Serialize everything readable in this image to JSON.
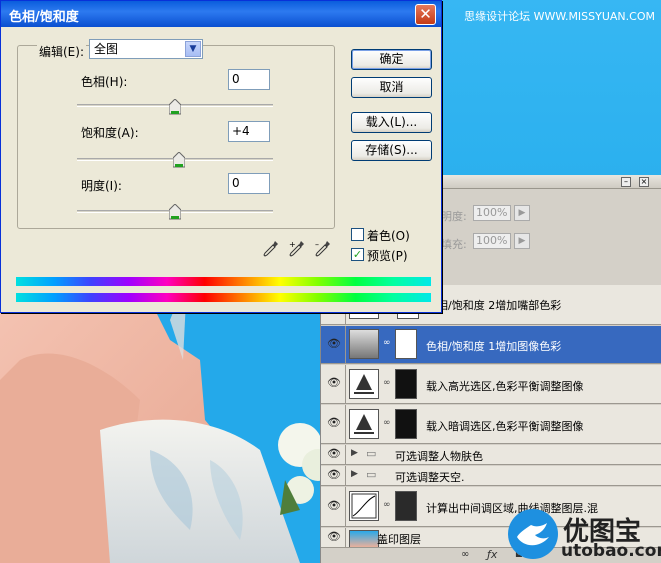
{
  "watermark_top": "思缘设计论坛 WWW.MISSYUAN.COM",
  "dialog": {
    "title": "色相/饱和度",
    "close_glyph": "✕",
    "edit_label": "编辑(E):",
    "edit_value": "全图",
    "sliders": [
      {
        "label": "色相(H):",
        "value": "0",
        "position": 0.5
      },
      {
        "label": "饱和度(A):",
        "value": "+4",
        "position": 0.52
      },
      {
        "label": "明度(I):",
        "value": "0",
        "position": 0.5
      }
    ],
    "buttons": {
      "ok": "确定",
      "cancel": "取消",
      "load": "载入(L)...",
      "save": "存储(S)..."
    },
    "colorize_label": "着色(O)",
    "colorize_checked": false,
    "preview_label": "预览(P)",
    "preview_checked": true,
    "accent_color": "#0a5ddc"
  },
  "layers_panel": {
    "opacity_label": "明度:",
    "opacity_value": "100%",
    "fill_label": "填充:",
    "fill_value": "100%",
    "layers": [
      {
        "name": "色相/饱和度 2增加嘴部色彩",
        "visible": false,
        "selected": false,
        "type": "adjustment"
      },
      {
        "name": "色相/饱和度 1增加图像色彩",
        "visible": true,
        "selected": true,
        "type": "adjustment"
      },
      {
        "name": "载入高光选区,色彩平衡调整图像",
        "visible": true,
        "selected": false,
        "type": "adjustment"
      },
      {
        "name": "载入暗调选区,色彩平衡调整图像",
        "visible": true,
        "selected": false,
        "type": "adjustment"
      },
      {
        "name": "可选调整人物肤色",
        "visible": true,
        "selected": false,
        "type": "group"
      },
      {
        "name": "可选调整天空.",
        "visible": true,
        "selected": false,
        "type": "group"
      },
      {
        "name": "计算出中间调区域,曲线调整图层.混",
        "visible": true,
        "selected": false,
        "type": "adjustment"
      },
      {
        "name": "盖印图层",
        "visible": true,
        "selected": false,
        "type": "pixel"
      }
    ],
    "selected_color": "#3769bf"
  },
  "logo": {
    "text": "优图宝",
    "url": "utobao.com"
  }
}
